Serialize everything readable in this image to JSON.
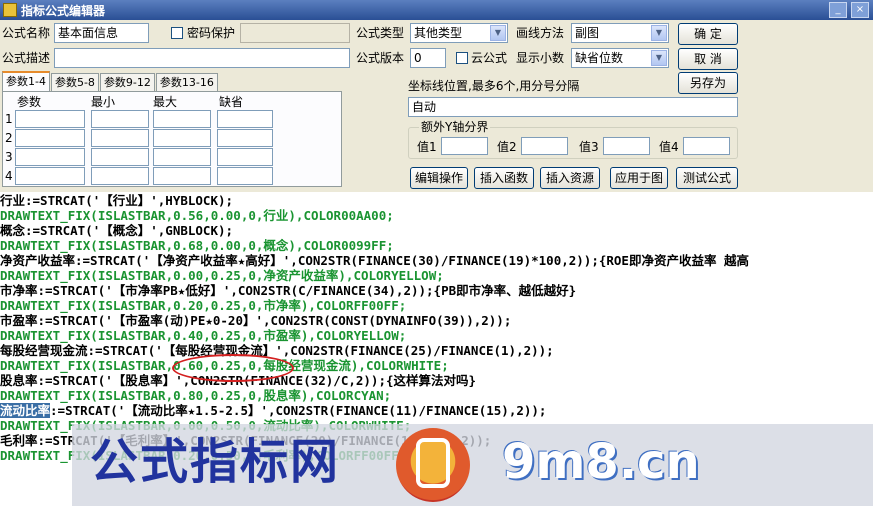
{
  "window": {
    "title": "指标公式编辑器",
    "min": "_",
    "close": "×"
  },
  "form": {
    "name_label": "公式名称",
    "name_value": "基本面信息",
    "password_label": "密码保护",
    "type_label": "公式类型",
    "type_value": "其他类型",
    "draw_label": "画线方法",
    "draw_value": "副图",
    "ok": "确  定",
    "desc_label": "公式描述",
    "version_label": "公式版本",
    "version_value": "0",
    "cloud_label": "云公式",
    "decimal_label": "显示小数",
    "decimal_value": "缺省位数",
    "cancel": "取  消",
    "saveas": "另存为",
    "axis_label": "坐标线位置,最多6个,用分号分隔",
    "axis_value": "自动",
    "extra_y_label": "额外Y轴分界",
    "val_labels": [
      "值1",
      "值2",
      "值3",
      "值4"
    ]
  },
  "tabs": [
    "参数1-4",
    "参数5-8",
    "参数9-12",
    "参数13-16"
  ],
  "params": {
    "headers": [
      "参数",
      "最小",
      "最大",
      "缺省"
    ],
    "rows": [
      "1",
      "2",
      "3",
      "4"
    ]
  },
  "buttons": [
    "编辑操作",
    "插入函数",
    "插入资源",
    "应用于图",
    "测试公式"
  ],
  "code_lines": [
    {
      "t": "def",
      "text": "行业:=STRCAT('【行业】',HYBLOCK);"
    },
    {
      "t": "dt",
      "text": "DRAWTEXT_FIX(ISLASTBAR,0.56,0.00,0,行业),COLOR00AA00;"
    },
    {
      "t": "def",
      "text": "概念:=STRCAT('【概念】',GNBLOCK);"
    },
    {
      "t": "dt",
      "text": "DRAWTEXT_FIX(ISLASTBAR,0.68,0.00,0,概念),COLOR0099FF;"
    },
    {
      "t": "def",
      "text": "净资产收益率:=STRCAT('【净资产收益率★高好】',CON2STR(FINANCE(30)/FINANCE(19)*100,2));{ROE即净资产收益率 越高"
    },
    {
      "t": "dt",
      "text": "DRAWTEXT_FIX(ISLASTBAR,0.00,0.25,0,净资产收益率),COLORYELLOW;"
    },
    {
      "t": "def",
      "text": "市净率:=STRCAT('【市净率PB★低好】',CON2STR(C/FINANCE(34),2));{PB即市净率、越低越好}"
    },
    {
      "t": "dt",
      "text": "DRAWTEXT_FIX(ISLASTBAR,0.20,0.25,0,市净率),COLORFF00FF;"
    },
    {
      "t": "def",
      "text": "市盈率:=STRCAT('【市盈率(动)PE★0-20】',CON2STR(CONST(DYNAINFO(39)),2));"
    },
    {
      "t": "dt",
      "text": "DRAWTEXT_FIX(ISLASTBAR,0.40,0.25,0,市盈率),COLORYELLOW;"
    },
    {
      "t": "def",
      "text": "每股经营现金流:=STRCAT('【每股经营现金流】',CON2STR(FINANCE(25)/FINANCE(1),2));"
    },
    {
      "t": "dt",
      "text": "DRAWTEXT_FIX(ISLASTBAR,0.60,0.25,0,每股经营现金流),COLORWHITE;"
    },
    {
      "t": "def",
      "text": "股息率:=STRCAT('【股息率】',CON2STR(FINANCE(32)/C,2));{这样算法对吗}"
    },
    {
      "t": "dt",
      "text": "DRAWTEXT_FIX(ISLASTBAR,0.80,0.25,0,股息率),COLORCYAN;"
    },
    {
      "t": "sel",
      "text": "流动比率:=STRCAT('【流动比率★1.5-2.5】',CON2STR(FINANCE(11)/FINANCE(15),2));"
    },
    {
      "t": "dt",
      "text": "DRAWTEXT_FIX(ISLASTBAR,0.00,0.50,0,流动比率),COLORWHITE;"
    },
    {
      "t": "def",
      "text": "毛利率:=STRCAT('【毛利率】',CON2STR(FINANCE(20)/FINANCE(18)*100,2));"
    },
    {
      "t": "dt",
      "text": "DRAWTEXT_FIX(ISLASTBAR,0.20,0.50,0,毛利率),COLORFF00FF;"
    }
  ],
  "banner": {
    "text": "公式指标网",
    "url": "9m8.cn"
  }
}
